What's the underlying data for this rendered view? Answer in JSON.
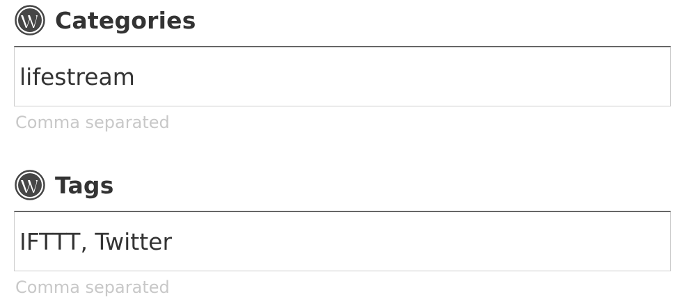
{
  "categories": {
    "icon": "wordpress-icon",
    "label": "Categories",
    "value": "lifestream",
    "hint": "Comma separated"
  },
  "tags": {
    "icon": "wordpress-icon",
    "label": "Tags",
    "value": "IFTTT, Twitter",
    "hint": "Comma separated"
  },
  "colors": {
    "text": "#333333",
    "hint": "#c8c8c8",
    "input_border": "#cccccc",
    "input_border_top": "#666666",
    "icon": "#464646"
  }
}
